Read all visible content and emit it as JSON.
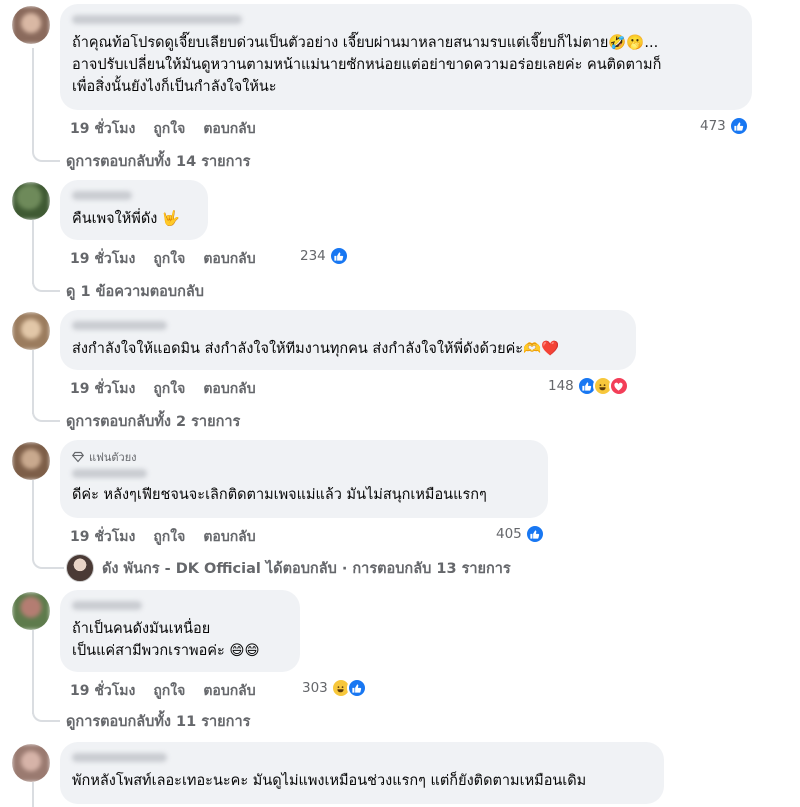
{
  "comments": [
    {
      "text": "ถ้าคุณท้อโปรดดูเจี๊ยบเลียบด่วนเป็นตัวอย่าง เจี๊ยบผ่านมาหลายสนามรบแต่เจี๊ยบก็ไม่ตาย🤣🫢...\nอาจปรับเปลี่ยนให้มันดูหวานตามหน้าแม่นายซักหน่อยแต่อย่าขาดความอร่อยเลยค่ะ คนติดตามก็\nเพื่อสิ่งนั้นยังไงก็เป็นกำลังใจให้นะ",
      "time": "19 ชั่วโมง",
      "like": "ถูกใจ",
      "reply": "ตอบกลับ",
      "reactions": "473",
      "view_replies": "ดูการตอบกลับทั้ง 14 รายการ"
    },
    {
      "text": "คืนเพจให้พี่ดัง 🤟",
      "time": "19 ชั่วโมง",
      "like": "ถูกใจ",
      "reply": "ตอบกลับ",
      "reactions": "234",
      "view_replies": "ดู 1 ข้อความตอบกลับ"
    },
    {
      "text": "ส่งกำลังใจให้แอดมิน ส่งกำลังใจให้ทีมงานทุกคน ส่งกำลังใจให้พี่ดังด้วยค่ะ🫶❤️",
      "time": "19 ชั่วโมง",
      "like": "ถูกใจ",
      "reply": "ตอบกลับ",
      "reactions": "148",
      "view_replies": "ดูการตอบกลับทั้ง 2 รายการ"
    },
    {
      "badge": "แฟนตัวยง",
      "text": "ดีค่ะ หลังๆเฟียชจนจะเลิกติดตามเพจแม่แล้ว มันไม่สนุกเหมือนแรกๆ",
      "time": "19 ชั่วโมง",
      "like": "ถูกใจ",
      "reply": "ตอบกลับ",
      "reactions": "405",
      "page_reply": "ดัง พันกร - DK Official ได้ตอบกลับ · การตอบกลับ 13 รายการ"
    },
    {
      "text": "ถ้าเป็นคนดังมันเหนื่อย\nเป็นแค่สามีพวกเราพอค่ะ 😄😄",
      "time": "19 ชั่วโมง",
      "like": "ถูกใจ",
      "reply": "ตอบกลับ",
      "reactions": "303",
      "view_replies": "ดูการตอบกลับทั้ง 11 รายการ"
    },
    {
      "text": "พักหลังโพสท์เลอะเทอะนะคะ มันดูไม่แพงเหมือนช่วงแรกๆ แต่ก็ยังติดตามเหมือนเดิม"
    }
  ],
  "colors": {
    "bubble": "#f0f2f5",
    "like_blue": "#1877f2",
    "meta_gray": "#65676b"
  },
  "icons": [
    "like-icon",
    "haha-icon",
    "love-icon",
    "diamond-icon"
  ]
}
